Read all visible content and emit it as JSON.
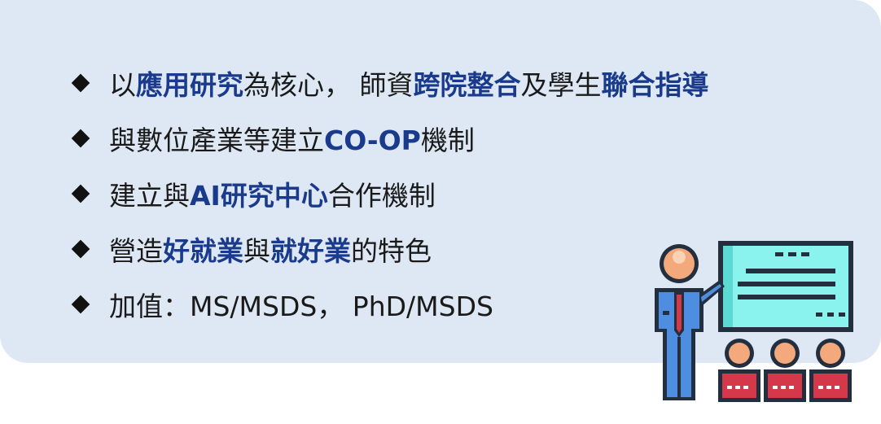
{
  "bullets": [
    {
      "segments": [
        {
          "text": "以",
          "highlight": false
        },
        {
          "text": "應用研究",
          "highlight": true
        },
        {
          "text": "為核心， 師資",
          "highlight": false
        },
        {
          "text": "跨院整合",
          "highlight": true
        },
        {
          "text": "及學生",
          "highlight": false
        },
        {
          "text": "聯合指導",
          "highlight": true
        }
      ]
    },
    {
      "segments": [
        {
          "text": "與數位產業等建立",
          "highlight": false
        },
        {
          "text": "CO-OP",
          "highlight": true
        },
        {
          "text": "機制",
          "highlight": false
        }
      ]
    },
    {
      "segments": [
        {
          "text": "建立與",
          "highlight": false
        },
        {
          "text": "AI研究中心",
          "highlight": true
        },
        {
          "text": "合作機制",
          "highlight": false
        }
      ]
    },
    {
      "segments": [
        {
          "text": "營造",
          "highlight": false
        },
        {
          "text": "好就業",
          "highlight": true
        },
        {
          "text": "與",
          "highlight": false
        },
        {
          "text": "就好業",
          "highlight": true
        },
        {
          "text": "的特色",
          "highlight": false
        }
      ]
    },
    {
      "segments": [
        {
          "text": "加值：MS/MSDS， PhD/MSDS",
          "highlight": false
        }
      ]
    }
  ],
  "colors": {
    "panel_background": "#dde8f4",
    "highlight_text": "#1a3a8c",
    "body_text": "#1a1a1a"
  },
  "icons": {
    "bullet": "diamond-bullet-icon",
    "illustration": "presentation-teacher-icon"
  }
}
